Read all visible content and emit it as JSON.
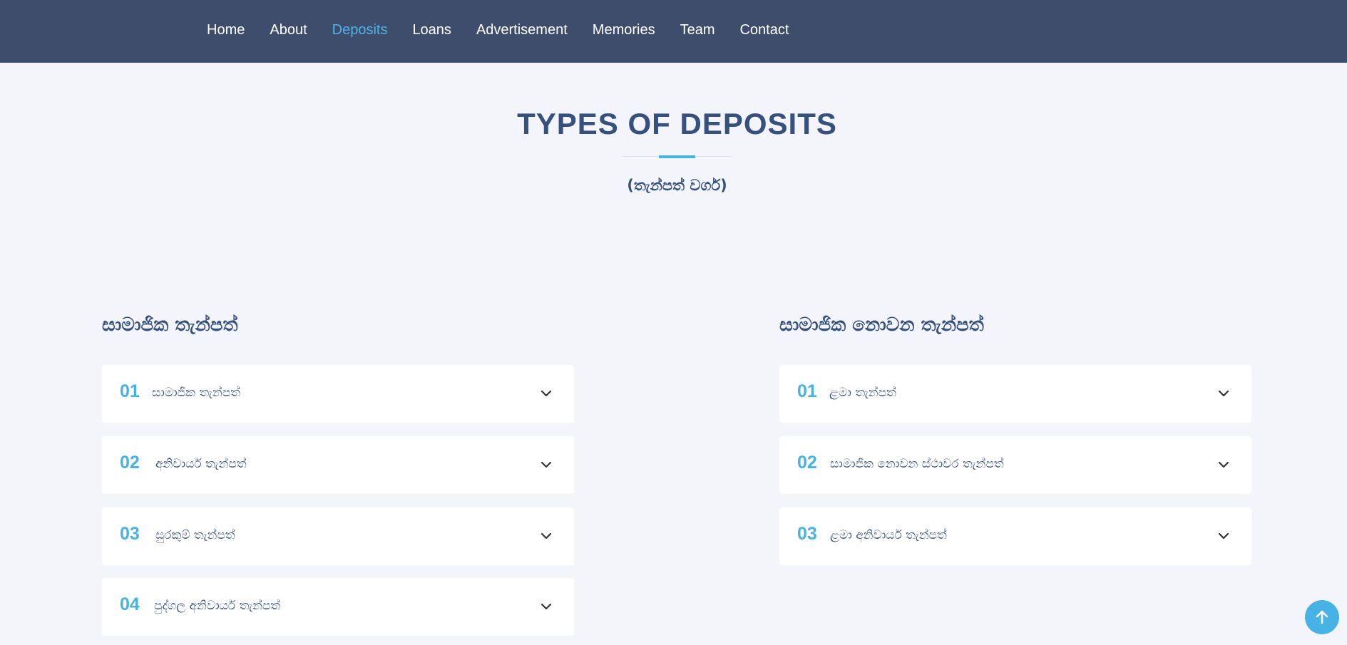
{
  "nav": {
    "items": [
      {
        "label": "Home"
      },
      {
        "label": "About"
      },
      {
        "label": "Deposits",
        "active": true
      },
      {
        "label": "Loans"
      },
      {
        "label": "Advertisement"
      },
      {
        "label": "Memories"
      },
      {
        "label": "Team"
      },
      {
        "label": "Contact"
      }
    ]
  },
  "section": {
    "title": "TYPES OF DEPOSITS",
    "subtitle": "(තැන්පත් වර්ග)"
  },
  "left_column": {
    "heading": "සාමාජික තැන්පත්",
    "items": [
      {
        "num": "01",
        "label": "සාමාජික තැන්පත්"
      },
      {
        "num": "02",
        "label": "අනිවාර්ය තැන්පත්"
      },
      {
        "num": "03",
        "label": "සුරකුම් තැන්පත්"
      },
      {
        "num": "04",
        "label": "පුද්ගල අනිවාර්ය තැන්පත්"
      }
    ]
  },
  "right_column": {
    "heading": "සාමාජික නොවන තැන්පත්",
    "items": [
      {
        "num": "01",
        "label": "ළමා තැන්පත්"
      },
      {
        "num": "02",
        "label": "සාමාජික නොවන ස්ථාවර තැන්පත්"
      },
      {
        "num": "03",
        "label": "ළමා අනිවාර්ය තැන්පත්"
      }
    ]
  },
  "icons": {
    "chevron": "chevron-down-icon",
    "back_to_top": "arrow-up-icon"
  },
  "colors": {
    "nav_bg": "#3d4d6b",
    "accent": "#47b2e4",
    "heading": "#37517e"
  }
}
